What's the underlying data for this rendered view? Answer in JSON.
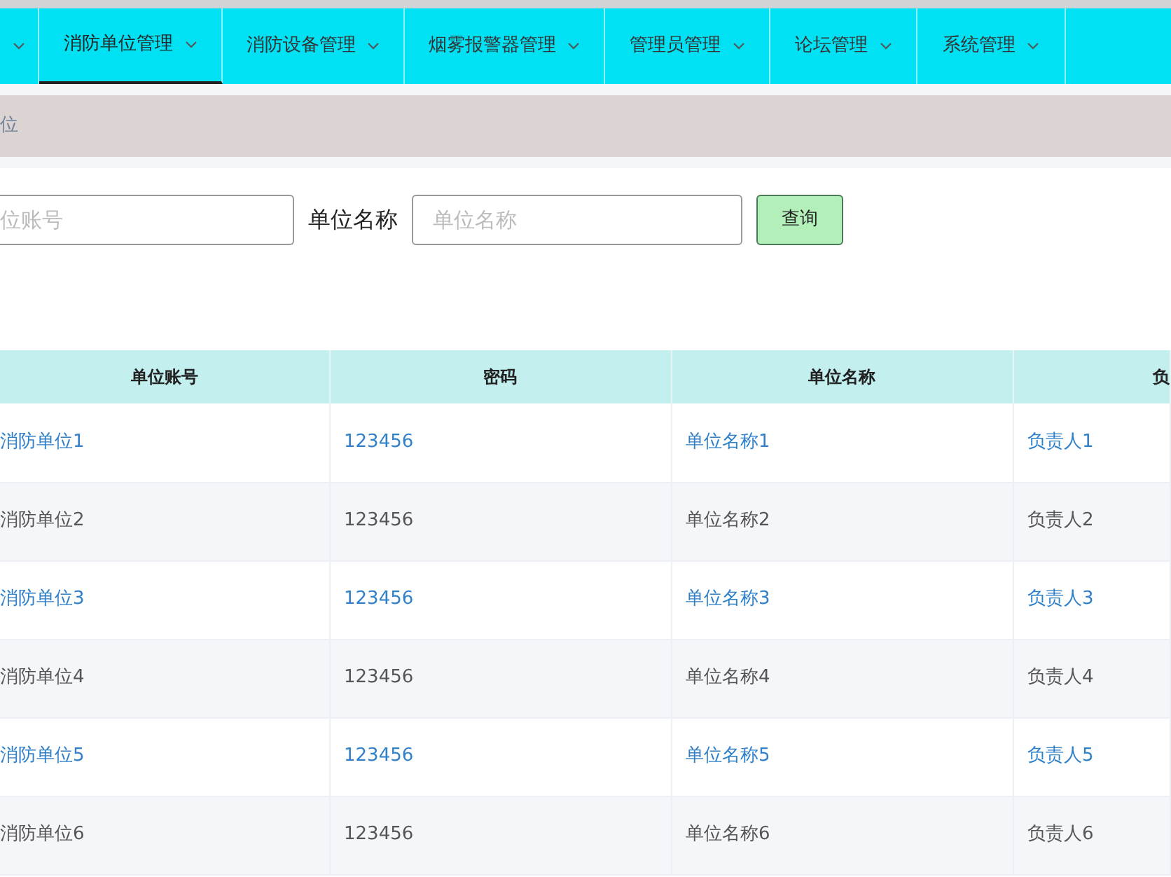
{
  "nav": [
    {
      "label": "消防单位管理",
      "selected": true
    },
    {
      "label": "消防设备管理",
      "selected": false
    },
    {
      "label": "烟雾报警器管理",
      "selected": false
    },
    {
      "label": "管理员管理",
      "selected": false
    },
    {
      "label": "论坛管理",
      "selected": false
    },
    {
      "label": "系统管理",
      "selected": false
    }
  ],
  "breadcrumb": "位",
  "search": {
    "fields": [
      {
        "placeholder": "位账号"
      },
      {
        "label": "单位名称",
        "placeholder": "单位名称"
      }
    ],
    "button": "查询"
  },
  "table": {
    "columns": [
      "单位账号",
      "密码",
      "单位名称",
      "负"
    ],
    "rows": [
      [
        "消防单位1",
        "123456",
        "单位名称1",
        "负责人1"
      ],
      [
        "消防单位2",
        "123456",
        "单位名称2",
        "负责人2"
      ],
      [
        "消防单位3",
        "123456",
        "单位名称3",
        "负责人3"
      ],
      [
        "消防单位4",
        "123456",
        "单位名称4",
        "负责人4"
      ],
      [
        "消防单位5",
        "123456",
        "单位名称5",
        "负责人5"
      ],
      [
        "消防单位6",
        "123456",
        "单位名称6",
        "负责人6"
      ]
    ]
  }
}
